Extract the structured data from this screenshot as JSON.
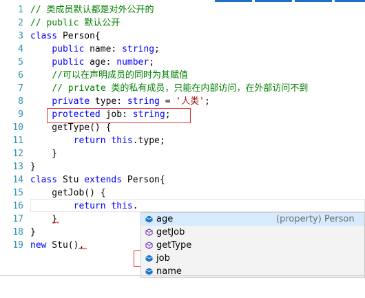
{
  "editor": {
    "lines": [
      {
        "num": "1",
        "tokens": [
          {
            "t": "// 类成员默认都是对外公开的",
            "c": "cm"
          }
        ]
      },
      {
        "num": "2",
        "tokens": [
          {
            "t": "// public 默认公开",
            "c": "cm"
          }
        ]
      },
      {
        "num": "3",
        "tokens": [
          {
            "t": "class",
            "c": "kw"
          },
          {
            "t": " Person{",
            "c": ""
          }
        ]
      },
      {
        "num": "4",
        "tokens": [
          {
            "t": "    ",
            "c": ""
          },
          {
            "t": "public",
            "c": "kw"
          },
          {
            "t": " name: ",
            "c": ""
          },
          {
            "t": "string",
            "c": "kw"
          },
          {
            "t": ";",
            "c": ""
          }
        ]
      },
      {
        "num": "5",
        "tokens": [
          {
            "t": "    ",
            "c": ""
          },
          {
            "t": "public",
            "c": "kw"
          },
          {
            "t": " age: ",
            "c": ""
          },
          {
            "t": "number",
            "c": "kw"
          },
          {
            "t": ";",
            "c": ""
          }
        ]
      },
      {
        "num": "6",
        "tokens": [
          {
            "t": "    ",
            "c": ""
          },
          {
            "t": "//可以在声明成员的同时为其赋值",
            "c": "cm"
          }
        ]
      },
      {
        "num": "7",
        "tokens": [
          {
            "t": "    ",
            "c": ""
          },
          {
            "t": "// private 类的私有成员，只能在内部访问，在外部访问不到",
            "c": "cm"
          }
        ]
      },
      {
        "num": "8",
        "tokens": [
          {
            "t": "    ",
            "c": ""
          },
          {
            "t": "private",
            "c": "kw"
          },
          {
            "t": " type: ",
            "c": ""
          },
          {
            "t": "string",
            "c": "kw"
          },
          {
            "t": " = ",
            "c": ""
          },
          {
            "t": "'人类'",
            "c": "str"
          },
          {
            "t": ";",
            "c": ""
          }
        ]
      },
      {
        "num": "9",
        "tokens": [
          {
            "t": "    ",
            "c": ""
          },
          {
            "t": "protected",
            "c": "kw"
          },
          {
            "t": " job: ",
            "c": ""
          },
          {
            "t": "string",
            "c": "kw"
          },
          {
            "t": ";",
            "c": ""
          }
        ]
      },
      {
        "num": "10",
        "tokens": [
          {
            "t": "    getType() {",
            "c": ""
          }
        ]
      },
      {
        "num": "11",
        "tokens": [
          {
            "t": "        ",
            "c": ""
          },
          {
            "t": "return",
            "c": "kw"
          },
          {
            "t": " ",
            "c": ""
          },
          {
            "t": "this",
            "c": "kw"
          },
          {
            "t": ".type;",
            "c": ""
          }
        ]
      },
      {
        "num": "12",
        "tokens": [
          {
            "t": "    }",
            "c": ""
          }
        ]
      },
      {
        "num": "13",
        "tokens": [
          {
            "t": "}",
            "c": ""
          }
        ]
      },
      {
        "num": "14",
        "tokens": [
          {
            "t": "class",
            "c": "kw"
          },
          {
            "t": " Stu ",
            "c": ""
          },
          {
            "t": "extends",
            "c": "kw"
          },
          {
            "t": " Person{",
            "c": ""
          }
        ]
      },
      {
        "num": "15",
        "tokens": [
          {
            "t": "    getJob() {",
            "c": ""
          }
        ]
      },
      {
        "num": "16",
        "tokens": [
          {
            "t": "        ",
            "c": ""
          },
          {
            "t": "return",
            "c": "kw"
          },
          {
            "t": " ",
            "c": ""
          },
          {
            "t": "this",
            "c": "kw"
          },
          {
            "t": ".",
            "c": ""
          }
        ]
      },
      {
        "num": "17",
        "tokens": [
          {
            "t": "    }",
            "c": ""
          }
        ]
      },
      {
        "num": "18",
        "tokens": [
          {
            "t": "}",
            "c": ""
          }
        ]
      },
      {
        "num": "19",
        "tokens": [
          {
            "t": "new",
            "c": "kw"
          },
          {
            "t": " Stu()",
            "c": ""
          },
          {
            "t": ",",
            "c": ""
          }
        ]
      }
    ]
  },
  "suggest": {
    "items": [
      {
        "label": "age",
        "detail": "(property) Person",
        "icon": "property-icon",
        "selected": true
      },
      {
        "label": "getJob",
        "detail": "",
        "icon": "method-icon",
        "selected": false
      },
      {
        "label": "getType",
        "detail": "",
        "icon": "method-icon",
        "selected": false
      },
      {
        "label": "job",
        "detail": "",
        "icon": "property-icon",
        "selected": false
      },
      {
        "label": "name",
        "detail": "",
        "icon": "property-icon",
        "selected": false
      }
    ]
  },
  "colors": {
    "keyword": "#0000ff",
    "comment": "#008000",
    "string": "#a31515",
    "line_number": "#2b91af",
    "annotation": "#e0312f",
    "selection": "#d6ebff"
  }
}
